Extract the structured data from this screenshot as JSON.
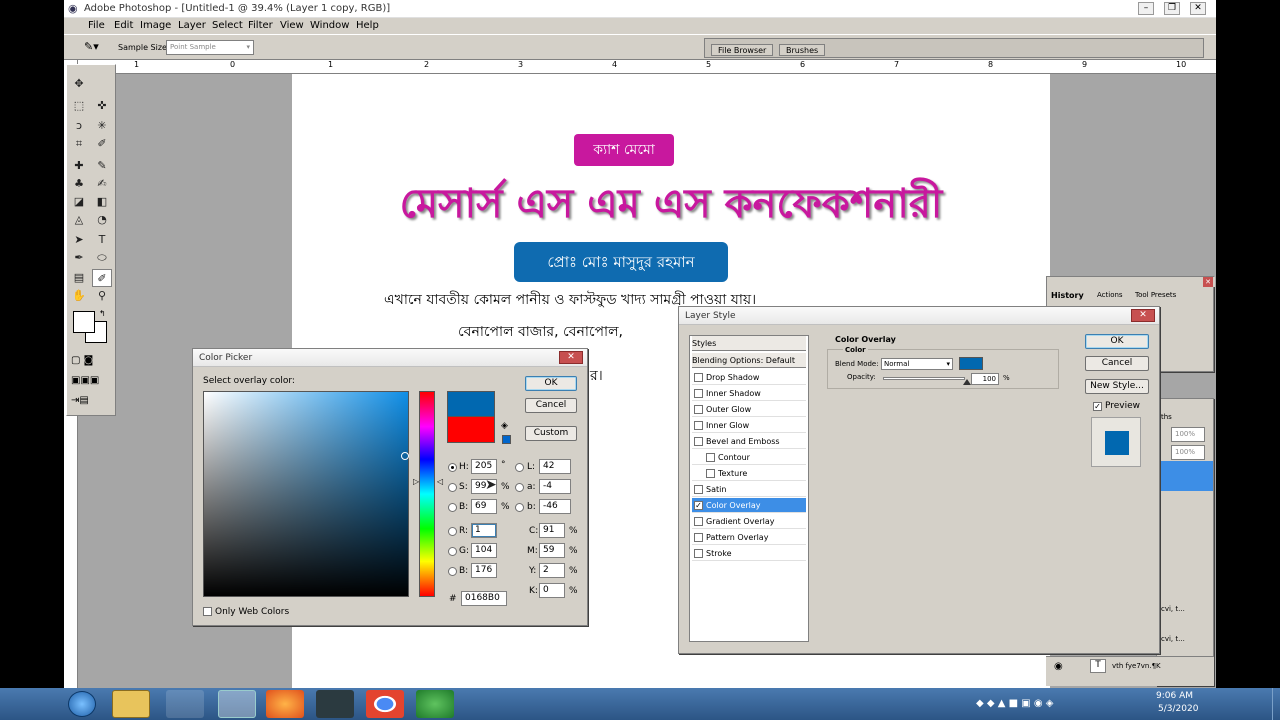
{
  "window": {
    "title": "Adobe Photoshop - [Untitled-1 @ 39.4% (Layer 1 copy, RGB)]"
  },
  "menu": [
    "File",
    "Edit",
    "Image",
    "Layer",
    "Select",
    "Filter",
    "View",
    "Window",
    "Help"
  ],
  "options": {
    "sample_size_label": "Sample Size:",
    "sample_size_value": "Point Sample"
  },
  "well_tabs": [
    "File Browser",
    "Brushes"
  ],
  "ruler_numbers": [
    "1",
    "0",
    "1",
    "2",
    "3",
    "4",
    "5",
    "6",
    "7",
    "8",
    "9",
    "10"
  ],
  "canvas": {
    "badge1": "ক্যাশ মেমো",
    "headline": "মেসার্স এস এম এস কনফেকশনারী",
    "badge2": "প্রোঃ মোঃ মাসুদুর রহমান",
    "line1": "এখানে যাবতীয় কোমল পানীয় ও ফাস্টফুড খাদ্য সামগ্রী পাওয়া যায়।",
    "line2": "বেনাপোল বাজার, বেনাপোল,",
    "line3": "র।",
    "colors": {
      "pink": "#c8189e",
      "blue": "#0f6bb0"
    }
  },
  "color_picker": {
    "title": "Color Picker",
    "select_label": "Select overlay color:",
    "ok": "OK",
    "cancel": "Cancel",
    "custom": "Custom",
    "fields": {
      "H": "205",
      "S": "99",
      "B": "69",
      "R": "1",
      "G": "104",
      "B2": "176",
      "L": "42",
      "a": "-4",
      "b": "-46",
      "C": "91",
      "M": "59",
      "Y": "2",
      "K": "0",
      "hex": "0168B0"
    },
    "labels": {
      "H": "H:",
      "S": "S:",
      "B": "B:",
      "R": "R:",
      "G": "G:",
      "B2": "B:",
      "L": "L:",
      "a": "a:",
      "b": "b:",
      "C": "C:",
      "M": "M:",
      "Y": "Y:",
      "K": "K:",
      "hash": "#",
      "deg": "°",
      "pct": "%"
    },
    "only_web": "Only Web Colors",
    "new_color": "#0168b0",
    "old_color": "#ff0000"
  },
  "layer_style": {
    "title": "Layer Style",
    "styles_header": "Styles",
    "blending": "Blending Options: Default",
    "items": [
      {
        "label": "Drop Shadow",
        "checked": false,
        "indent": false
      },
      {
        "label": "Inner Shadow",
        "checked": false,
        "indent": false
      },
      {
        "label": "Outer Glow",
        "checked": false,
        "indent": false
      },
      {
        "label": "Inner Glow",
        "checked": false,
        "indent": false
      },
      {
        "label": "Bevel and Emboss",
        "checked": false,
        "indent": false
      },
      {
        "label": "Contour",
        "checked": false,
        "indent": true
      },
      {
        "label": "Texture",
        "checked": false,
        "indent": true
      },
      {
        "label": "Satin",
        "checked": false,
        "indent": false
      },
      {
        "label": "Color Overlay",
        "checked": true,
        "indent": false
      },
      {
        "label": "Gradient Overlay",
        "checked": false,
        "indent": false
      },
      {
        "label": "Pattern Overlay",
        "checked": false,
        "indent": false
      },
      {
        "label": "Stroke",
        "checked": false,
        "indent": false
      }
    ],
    "section_title": "Color Overlay",
    "group_title": "Color",
    "blend_mode_label": "Blend Mode:",
    "blend_mode_value": "Normal",
    "opacity_label": "Opacity:",
    "opacity_value": "100",
    "pct": "%",
    "ok": "OK",
    "cancel": "Cancel",
    "new_style": "New Style...",
    "preview_label": "Preview"
  },
  "history_panel": {
    "tabs": [
      "History",
      "Actions",
      "Tool Presets"
    ]
  },
  "layers_panel": {
    "tab_end": "ths",
    "opacity1": "100%",
    "opacity2": "100%",
    "row_a": "cvi, t...",
    "row_b": "cvi, t...",
    "row_c": "vth fye7vn.¶K"
  },
  "taskbar": {
    "time": "9:06 AM",
    "date": "5/3/2020"
  }
}
